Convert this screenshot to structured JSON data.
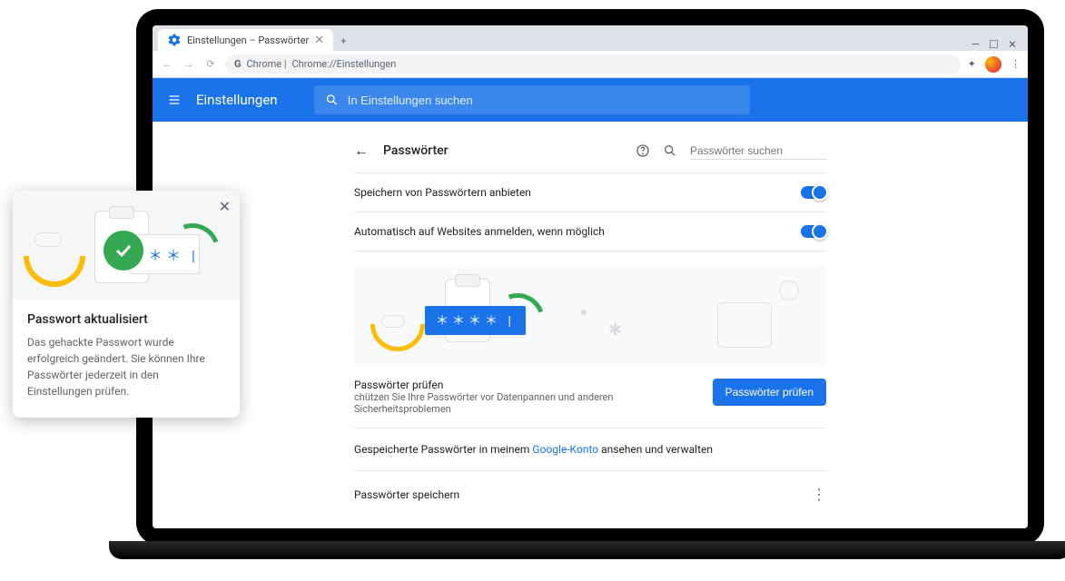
{
  "browser": {
    "tab_title": "Einstellungen – Passwörter",
    "url_prefix": "Chrome |",
    "url": "Chrome://Einstellungen",
    "window_controls": {
      "min": "—",
      "max": "☐",
      "close": "✕"
    }
  },
  "header": {
    "title": "Einstellungen",
    "search_placeholder": "In Einstellungen suchen"
  },
  "page": {
    "title": "Passwörter",
    "search_placeholder": "Passwörter suchen",
    "rows": {
      "offer_save": "Speichern von Passwörtern anbieten",
      "auto_signin": "Automatisch auf Websites anmelden, wenn möglich"
    },
    "check": {
      "title": "Passwörter prüfen",
      "desc": "chützen Sie Ihre Passwörter vor Datenpannen und anderen Sicherheitsproblemen",
      "button": "Passwörter prüfen"
    },
    "account_row_pre": "Gespeicherte Passwörter in meinem ",
    "account_link": "Google-Konto",
    "account_row_post": " ansehen und verwalten",
    "store_row": "Passwörter speichern"
  },
  "notification": {
    "title": "Passwort aktualisiert",
    "message": "Das gehackte Passwort wurde erfolgreich geändert. Sie können Ihre Passwörter jederzeit in den Einstellungen prüfen."
  }
}
